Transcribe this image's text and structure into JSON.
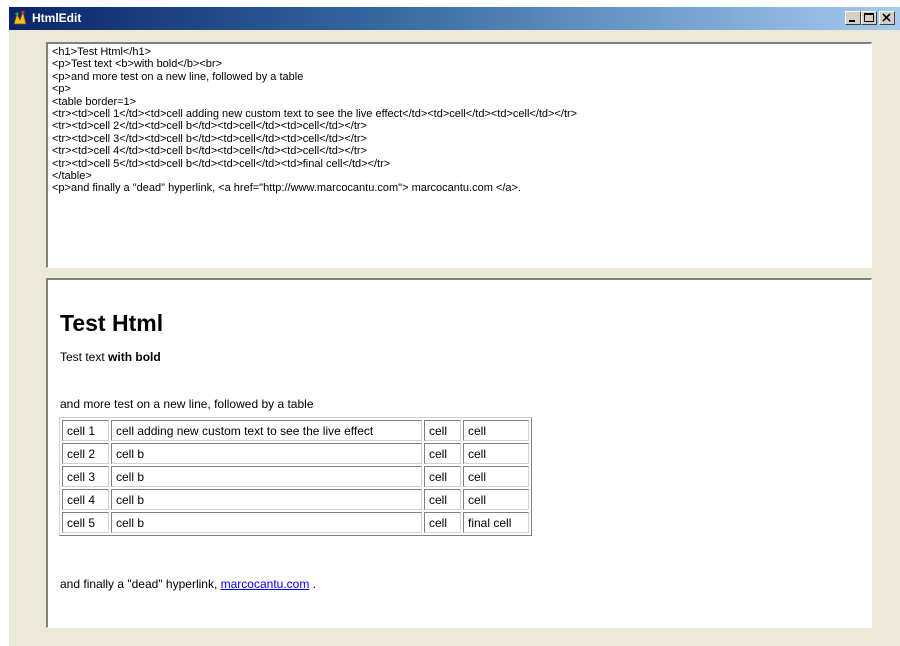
{
  "window": {
    "title": "HtmlEdit",
    "controls": {
      "minimize": "minimize",
      "maximize": "maximize",
      "close": "close"
    }
  },
  "editor": {
    "source": "<h1>Test Html</h1>\n<p>Test text <b>with bold</b><br>\n<p>and more test on a new line, followed by a table\n<p>\n<table border=1>\n<tr><td>cell 1</td><td>cell adding new custom text to see the live effect</td><td>cell</td><td>cell</td></tr>\n<tr><td>cell 2</td><td>cell b</td><td>cell</td><td>cell</td></tr>\n<tr><td>cell 3</td><td>cell b</td><td>cell</td><td>cell</td></tr>\n<tr><td>cell 4</td><td>cell b</td><td>cell</td><td>cell</td></tr>\n<tr><td>cell 5</td><td>cell b</td><td>cell</td><td>final cell</td></tr>\n</table>\n<p>and finally a \"dead\" hyperlink, <a href=\"http://www.marcocantu.com\"> marcocantu.com </a>."
  },
  "preview": {
    "heading": "Test Html",
    "para1_text": "Test text ",
    "para1_bold": "with bold",
    "para2": "and more test on a new line, followed by a table",
    "table": [
      [
        "cell 1",
        "cell adding new custom text to see the live effect",
        "cell",
        "cell"
      ],
      [
        "cell 2",
        "cell b",
        "cell",
        "cell"
      ],
      [
        "cell 3",
        "cell b",
        "cell",
        "cell"
      ],
      [
        "cell 4",
        "cell b",
        "cell",
        "cell"
      ],
      [
        "cell 5",
        "cell b",
        "cell",
        "final cell"
      ]
    ],
    "para3_text": "and finally a \"dead\" hyperlink, ",
    "link_text": "marcocantu.com",
    "para3_end": " ."
  },
  "colors": {
    "link": "#0000ee",
    "titlebar_start": "#0a246a",
    "titlebar_end": "#a6caf0",
    "face": "#ece9d8"
  }
}
